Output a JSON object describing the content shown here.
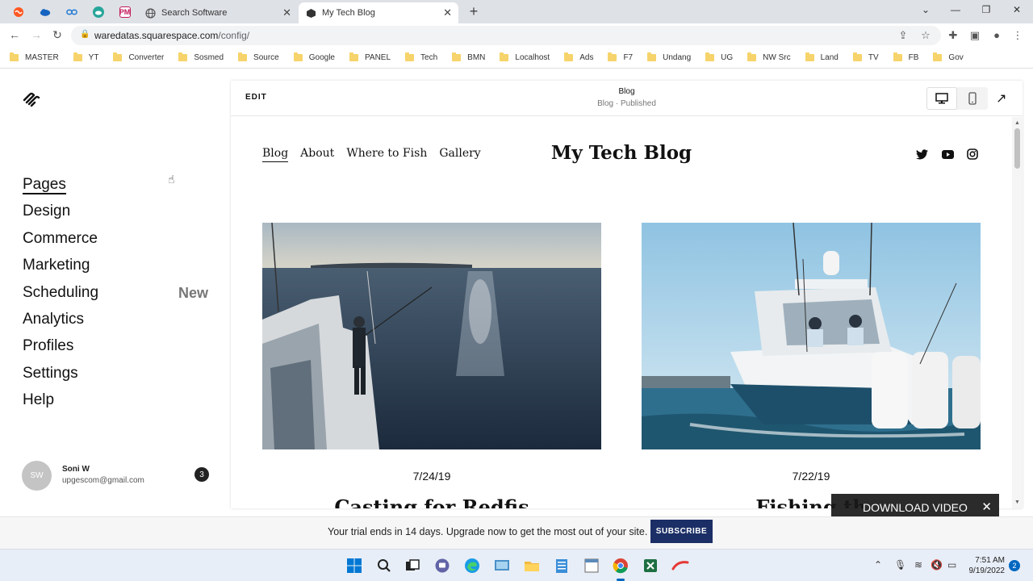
{
  "browser": {
    "tabs": [
      {
        "label": "Search Software",
        "active": false
      },
      {
        "label": "My Tech Blog",
        "active": true
      }
    ],
    "pinned_icons": [
      "wave-icon",
      "cloud-icon",
      "link-icon",
      "cloud-sync-icon",
      "pm-icon"
    ],
    "pinned_pm_text": "PM",
    "url_host": "waredatas.squarespace.com",
    "url_path": "/config/",
    "bookmarks": [
      "MASTER",
      "YT",
      "Converter",
      "Sosmed",
      "Source",
      "Google",
      "PANEL",
      "Tech",
      "BMN",
      "Localhost",
      "Ads",
      "F7",
      "Undang",
      "UG",
      "NW Src",
      "Land",
      "TV",
      "FB",
      "Gov"
    ]
  },
  "sidebar": {
    "items": [
      {
        "label": "Pages"
      },
      {
        "label": "Design"
      },
      {
        "label": "Commerce"
      },
      {
        "label": "Marketing"
      },
      {
        "label": "Scheduling",
        "badge": "New"
      },
      {
        "label": "Analytics"
      },
      {
        "label": "Profiles"
      },
      {
        "label": "Settings"
      },
      {
        "label": "Help"
      }
    ],
    "user": {
      "initials": "SW",
      "name": "Soni W",
      "email": "upgescom@gmail.com",
      "notifications": "3"
    }
  },
  "preview": {
    "edit_label": "EDIT",
    "page_title": "Blog",
    "page_status": "Blog · Published",
    "site": {
      "nav": [
        "Blog",
        "About",
        "Where to Fish",
        "Gallery"
      ],
      "title": "My Tech Blog",
      "social_icons": [
        "twitter-icon",
        "youtube-icon",
        "instagram-icon"
      ],
      "posts": [
        {
          "date": "7/24/19",
          "title": "Casting for Redfis"
        },
        {
          "date": "7/22/19",
          "title": "Fishing th"
        }
      ]
    }
  },
  "overlay": {
    "download_label": "DOWNLOAD VIDEO"
  },
  "trial": {
    "message": "Your trial ends in 14 days. Upgrade now to get the most out of your site.",
    "button": "SUBSCRIBE"
  },
  "taskbar": {
    "time": "7:51 AM",
    "date": "9/19/2022",
    "notifications": "2"
  },
  "colors": {
    "subscribe_bg": "#1b2f66",
    "tabstrip_bg": "#dee1e6",
    "taskbar_bg": "#e8eef7"
  }
}
